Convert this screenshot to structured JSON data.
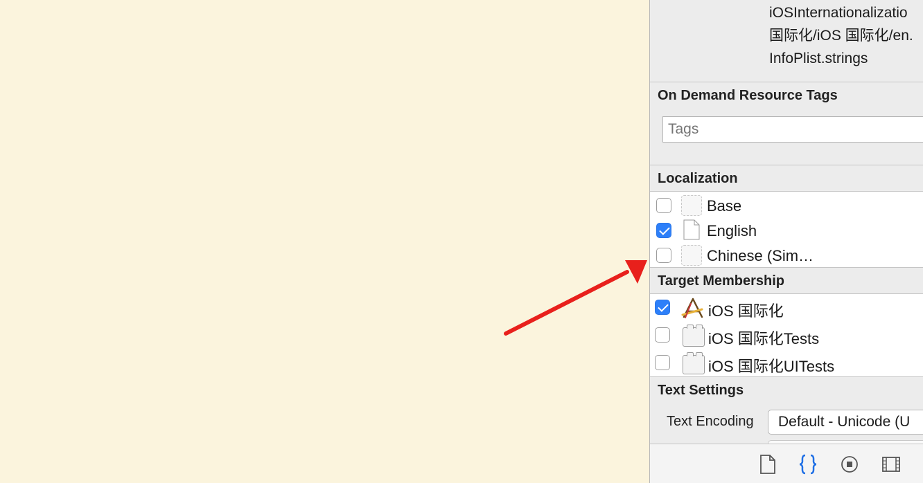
{
  "path_lines": [
    "iOSInternationalizatio",
    "国际化/iOS 国际化/en.",
    "InfoPlist.strings"
  ],
  "on_demand": {
    "header": "On Demand Resource Tags",
    "tags_placeholder": "Tags"
  },
  "localization": {
    "header": "Localization",
    "items": [
      {
        "label": "Base",
        "checked": false
      },
      {
        "label": "English",
        "checked": true
      },
      {
        "label": "Chinese (Sim…",
        "checked": false
      }
    ]
  },
  "target_membership": {
    "header": "Target Membership",
    "items": [
      {
        "label": "iOS 国际化",
        "checked": true,
        "icon": "app-target-icon"
      },
      {
        "label": "iOS 国际化Tests",
        "checked": false,
        "icon": "test-bundle-icon"
      },
      {
        "label": "iOS 国际化UITests",
        "checked": false,
        "icon": "test-bundle-icon"
      }
    ]
  },
  "text_settings": {
    "header": "Text Settings",
    "encoding_label": "Text Encoding",
    "encoding_value": "Default - Unicode (U"
  },
  "toolbar": {
    "icons": [
      "file-inspector-icon",
      "quick-help-icon",
      "identity-icon",
      "attributes-icon"
    ]
  },
  "colors": {
    "editor_bg": "#fbf4dd",
    "accent": "#2d7ff9",
    "arrow": "#e8201c",
    "selected_tab": "#1f6fe5"
  }
}
